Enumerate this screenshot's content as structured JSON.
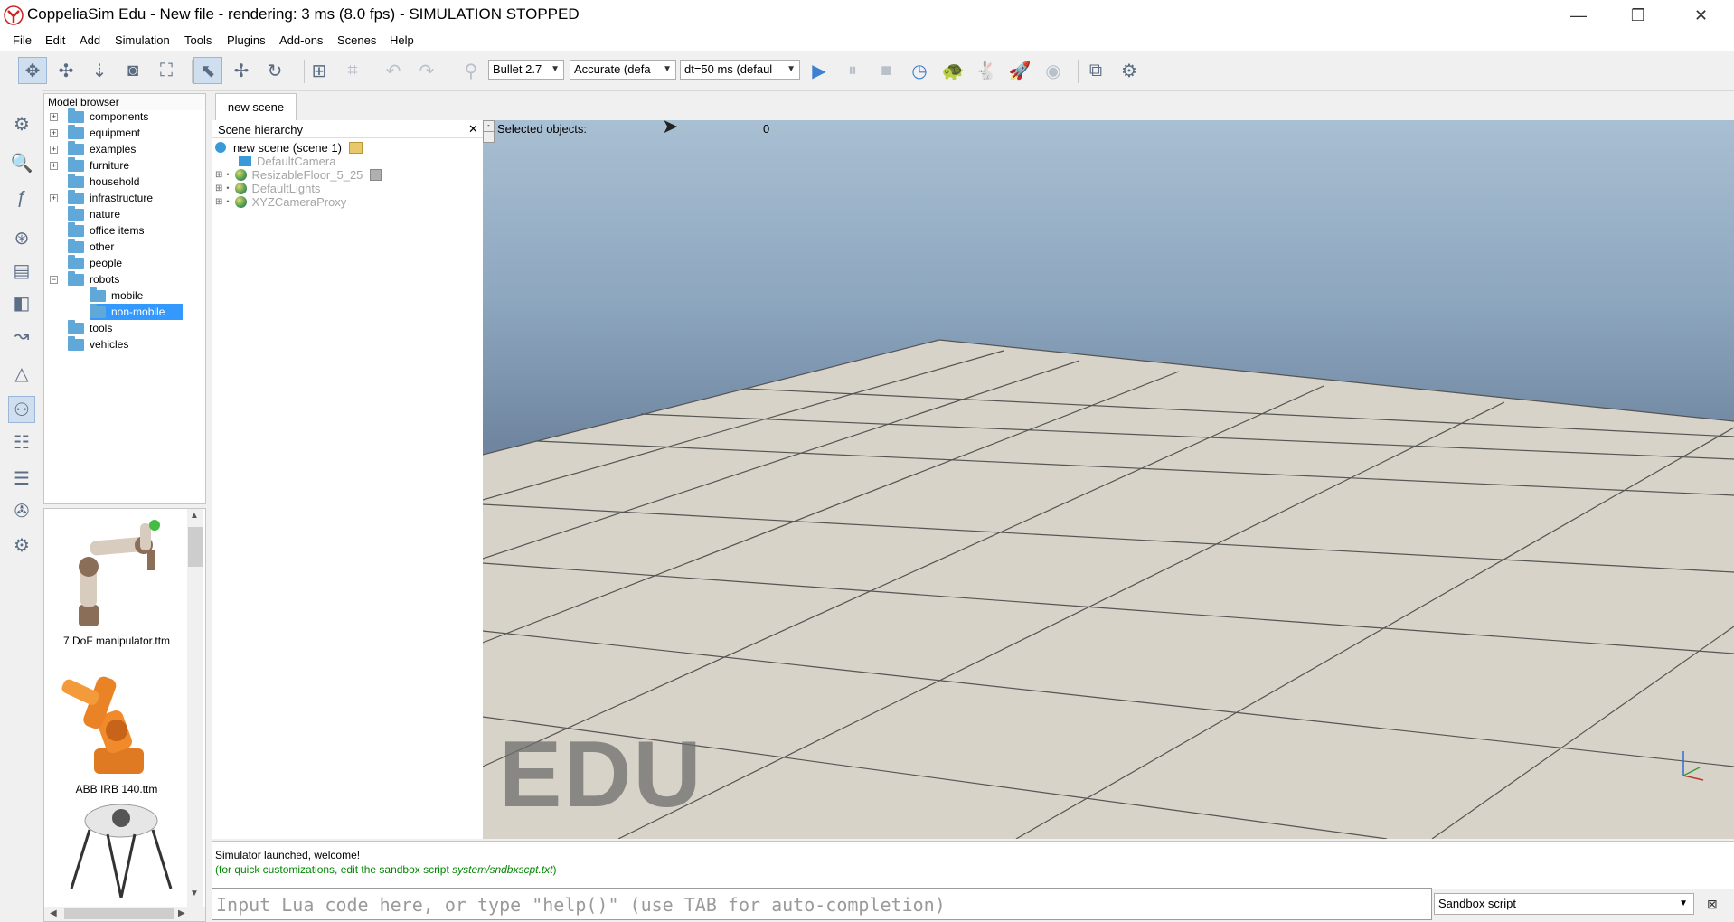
{
  "window": {
    "title": "CoppeliaSim Edu - New file - rendering: 3 ms (8.0 fps) - SIMULATION STOPPED",
    "controls": [
      "—",
      "❐",
      "✕"
    ]
  },
  "menu": [
    "File",
    "Edit",
    "Add",
    "Simulation",
    "Tools",
    "Plugins",
    "Add-ons",
    "Scenes",
    "Help"
  ],
  "toolbar": {
    "physics_engine": "Bullet 2.7",
    "accuracy": "Accurate (defa",
    "timestep": "dt=50 ms (defaul",
    "icons": [
      "camera-pan-icon",
      "camera-rotate-icon",
      "camera-shift-icon",
      "camera-angle-icon",
      "fit-to-view-icon",
      "object-select-icon",
      "object-move-icon",
      "object-rotate-icon",
      "assemble-icon",
      "transfer-dna-icon",
      "undo-icon",
      "redo-icon",
      "dynamic-content-icon",
      "play-icon",
      "pause-icon",
      "stop-icon",
      "real-time-icon",
      "slow-down-icon",
      "speed-up-icon",
      "thread-rendering-icon",
      "visualization-icon",
      "page-selector-icon",
      "scene-selector-icon"
    ]
  },
  "model_browser": {
    "title": "Model browser",
    "items": [
      {
        "label": "components",
        "expandable": true
      },
      {
        "label": "equipment",
        "expandable": true
      },
      {
        "label": "examples",
        "expandable": true
      },
      {
        "label": "furniture",
        "expandable": true
      },
      {
        "label": "household",
        "expandable": false
      },
      {
        "label": "infrastructure",
        "expandable": true
      },
      {
        "label": "nature",
        "expandable": false
      },
      {
        "label": "office items",
        "expandable": false
      },
      {
        "label": "other",
        "expandable": false
      },
      {
        "label": "people",
        "expandable": false
      },
      {
        "label": "robots",
        "expandable": true
      },
      {
        "label": "mobile",
        "expandable": false
      },
      {
        "label": "non-mobile",
        "expandable": false
      },
      {
        "label": "tools",
        "expandable": false
      },
      {
        "label": "vehicles",
        "expandable": false
      }
    ],
    "selected": "non-mobile"
  },
  "thumbnails": [
    {
      "label": "7 DoF manipulator.ttm"
    },
    {
      "label": "ABB IRB 140.ttm"
    },
    {
      "label": ""
    }
  ],
  "tabs": [
    "new scene"
  ],
  "scene_hierarchy": {
    "title": "Scene hierarchy",
    "root": "new scene (scene 1)",
    "objects": [
      "DefaultCamera",
      "ResizableFloor_5_25",
      "DefaultLights",
      "XYZCameraProxy"
    ]
  },
  "viewport": {
    "selected_label": "Selected objects:",
    "selected_count": "0",
    "watermark": "EDU"
  },
  "console": {
    "line1": "Simulator launched, welcome!",
    "line2_prefix": "(for quick customizations, edit the sandbox script ",
    "line2_path": "system/sndbxscpt.txt",
    "line2_suffix": ")",
    "input_placeholder": "Input Lua code here, or type \"help()\" (use TAB for auto-completion)",
    "script_selector": "Sandbox script"
  },
  "colors": {
    "selection": "#3399ff",
    "folder": "#5fa8d8",
    "sky_top": "#a9bfd2",
    "floor_tile": "#d8d3c8"
  }
}
